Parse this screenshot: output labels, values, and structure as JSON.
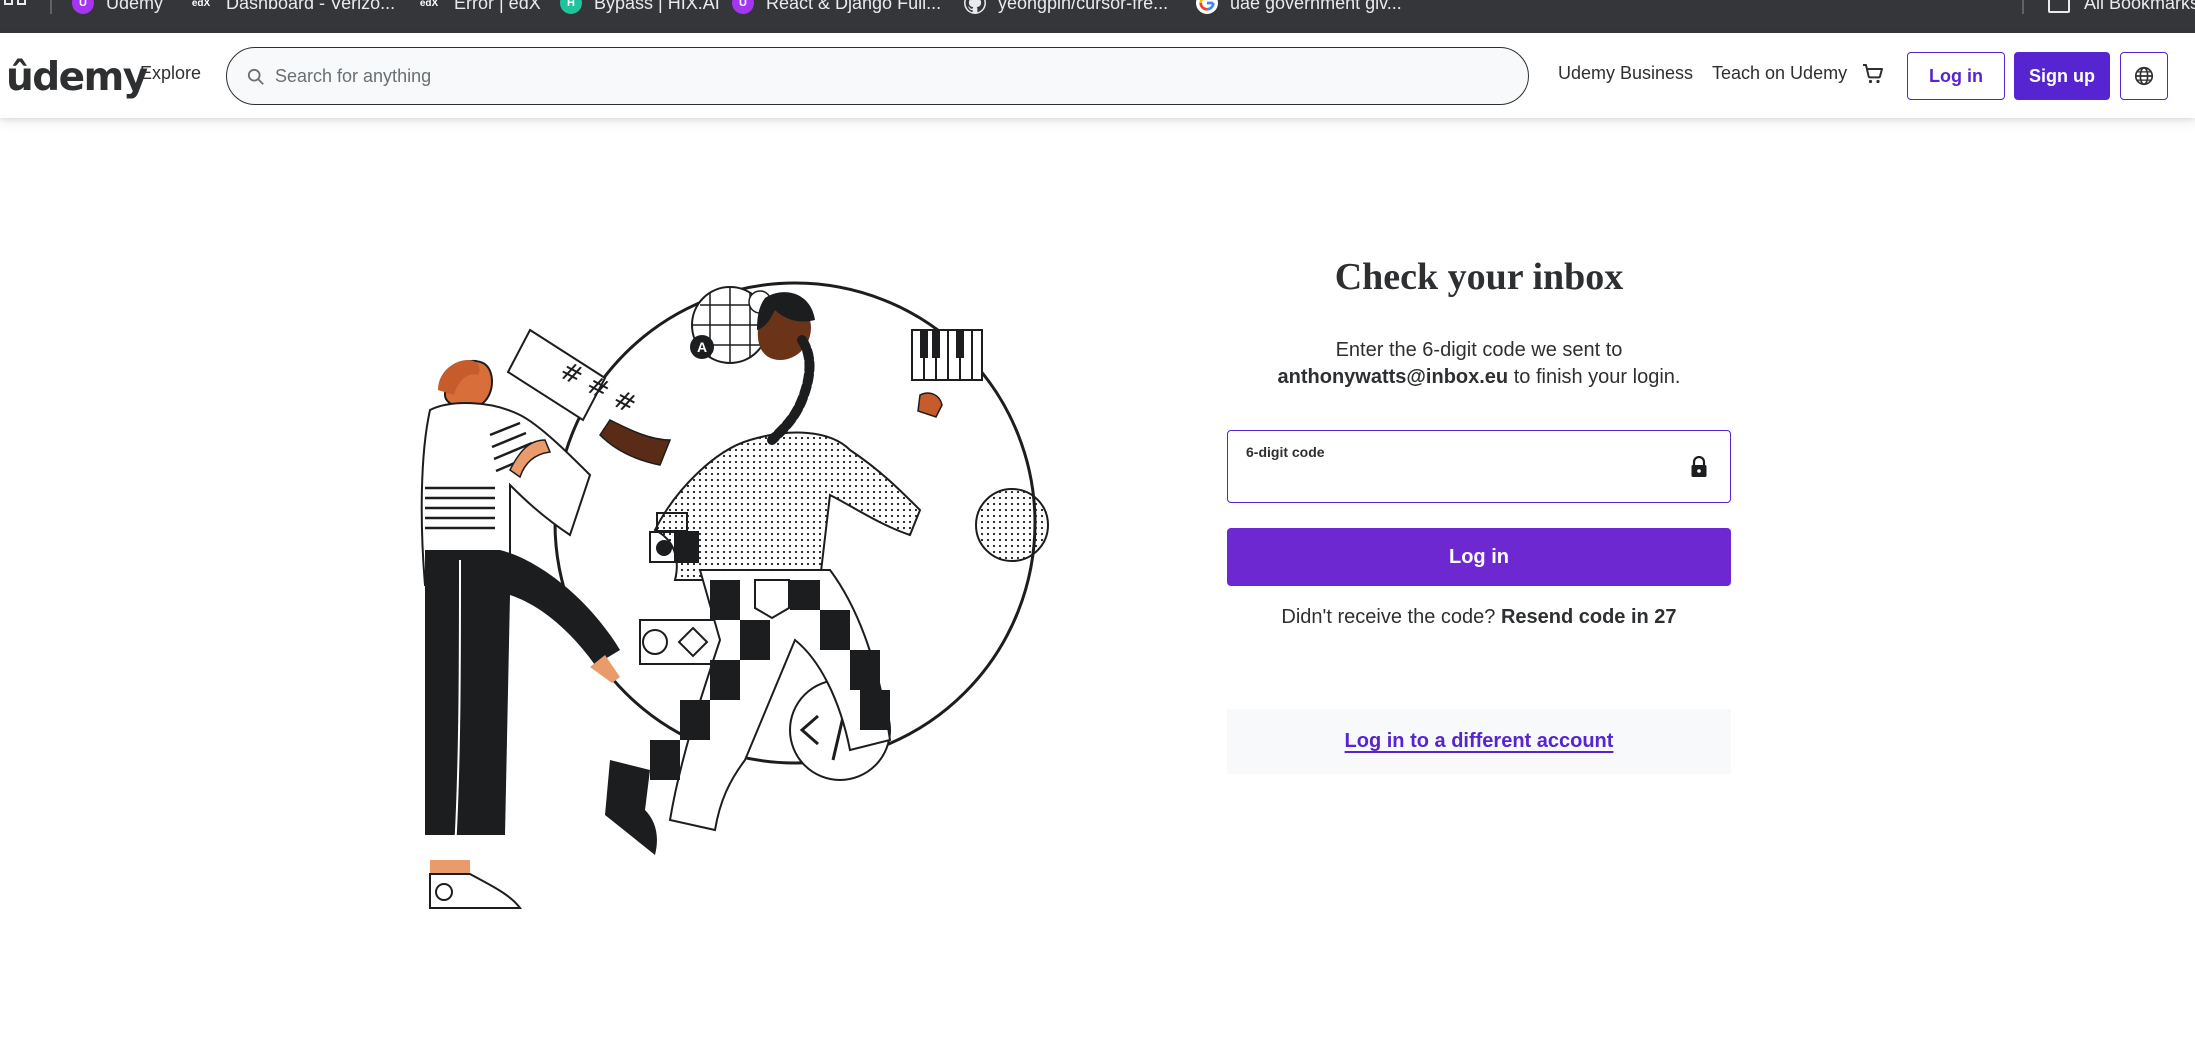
{
  "bookmarks": {
    "items": [
      {
        "label": "Udemy",
        "icon": "udemy-favicon",
        "color": "#a435f0",
        "glyph": "U"
      },
      {
        "label": "Dashboard - Verizo...",
        "icon": "edx-favicon",
        "color": "#35363a",
        "glyph": "edX"
      },
      {
        "label": "Error | edX",
        "icon": "edx-favicon",
        "color": "#35363a",
        "glyph": "edX"
      },
      {
        "label": "Bypass | HIX.AI",
        "icon": "hix-favicon",
        "color": "#1fc39d",
        "glyph": "H"
      },
      {
        "label": "React & Django Full...",
        "icon": "udemy-favicon",
        "color": "#a435f0",
        "glyph": "U"
      },
      {
        "label": "yeongpin/cursor-fre...",
        "icon": "github-favicon",
        "color": "#35363a",
        "glyph": ""
      },
      {
        "label": "uae government giv...",
        "icon": "google-favicon",
        "color": "#ffffff",
        "glyph": "G"
      }
    ],
    "all_bookmarks": "All Bookmarks"
  },
  "header": {
    "logo": "ûdemy",
    "explore": "Explore",
    "search_placeholder": "Search for anything",
    "udemy_business": "Udemy Business",
    "teach": "Teach on Udemy",
    "login": "Log in",
    "signup": "Sign up"
  },
  "form": {
    "title": "Check your inbox",
    "instruction_pre": "Enter the 6-digit code we sent to",
    "email": "anthonywatts@inbox.eu",
    "instruction_post": "to finish your login.",
    "code_label": "6-digit code",
    "code_value": "",
    "login_button": "Log in",
    "resend_prompt": "Didn't receive the code?",
    "resend_action": "Resend code in 27",
    "different_account": "Log in to a different account"
  },
  "colors": {
    "brand_purple": "#5624d0",
    "button_purple": "#6d28d2"
  }
}
